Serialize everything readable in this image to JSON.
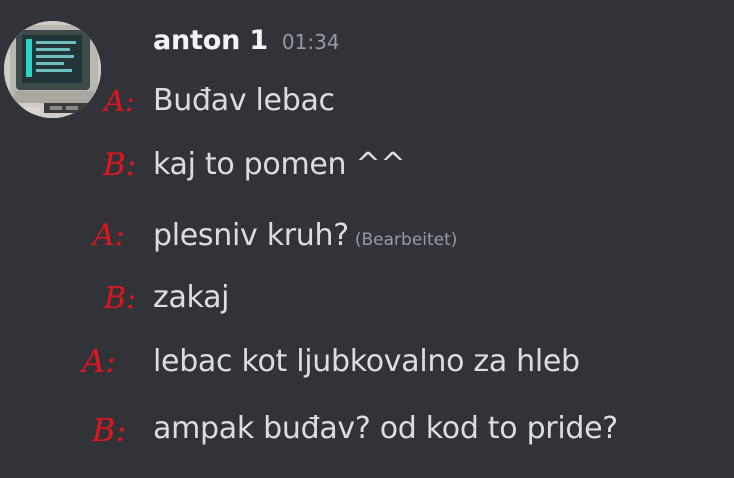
{
  "author": {
    "name": "anton 1",
    "time": "01:34"
  },
  "lines": [
    {
      "speaker": "A:",
      "text": "Buđav lebac"
    },
    {
      "speaker": "B:",
      "text": "kaj to pomen ^^"
    },
    {
      "speaker": "A:",
      "text": "plesniv kruh?",
      "edited": "(Bearbeitet)"
    },
    {
      "speaker": "B:",
      "text": "zakaj"
    },
    {
      "speaker": "A:",
      "text": "lebac kot ljubkovalno za hleb"
    },
    {
      "speaker": "B:",
      "text": "ampak buđav? od kod to pride?"
    }
  ],
  "colors": {
    "background": "#313338",
    "username": "#f2f3f5",
    "message_text": "#dbdee1",
    "muted": "#949ba4",
    "annotation": "#e1161c"
  }
}
